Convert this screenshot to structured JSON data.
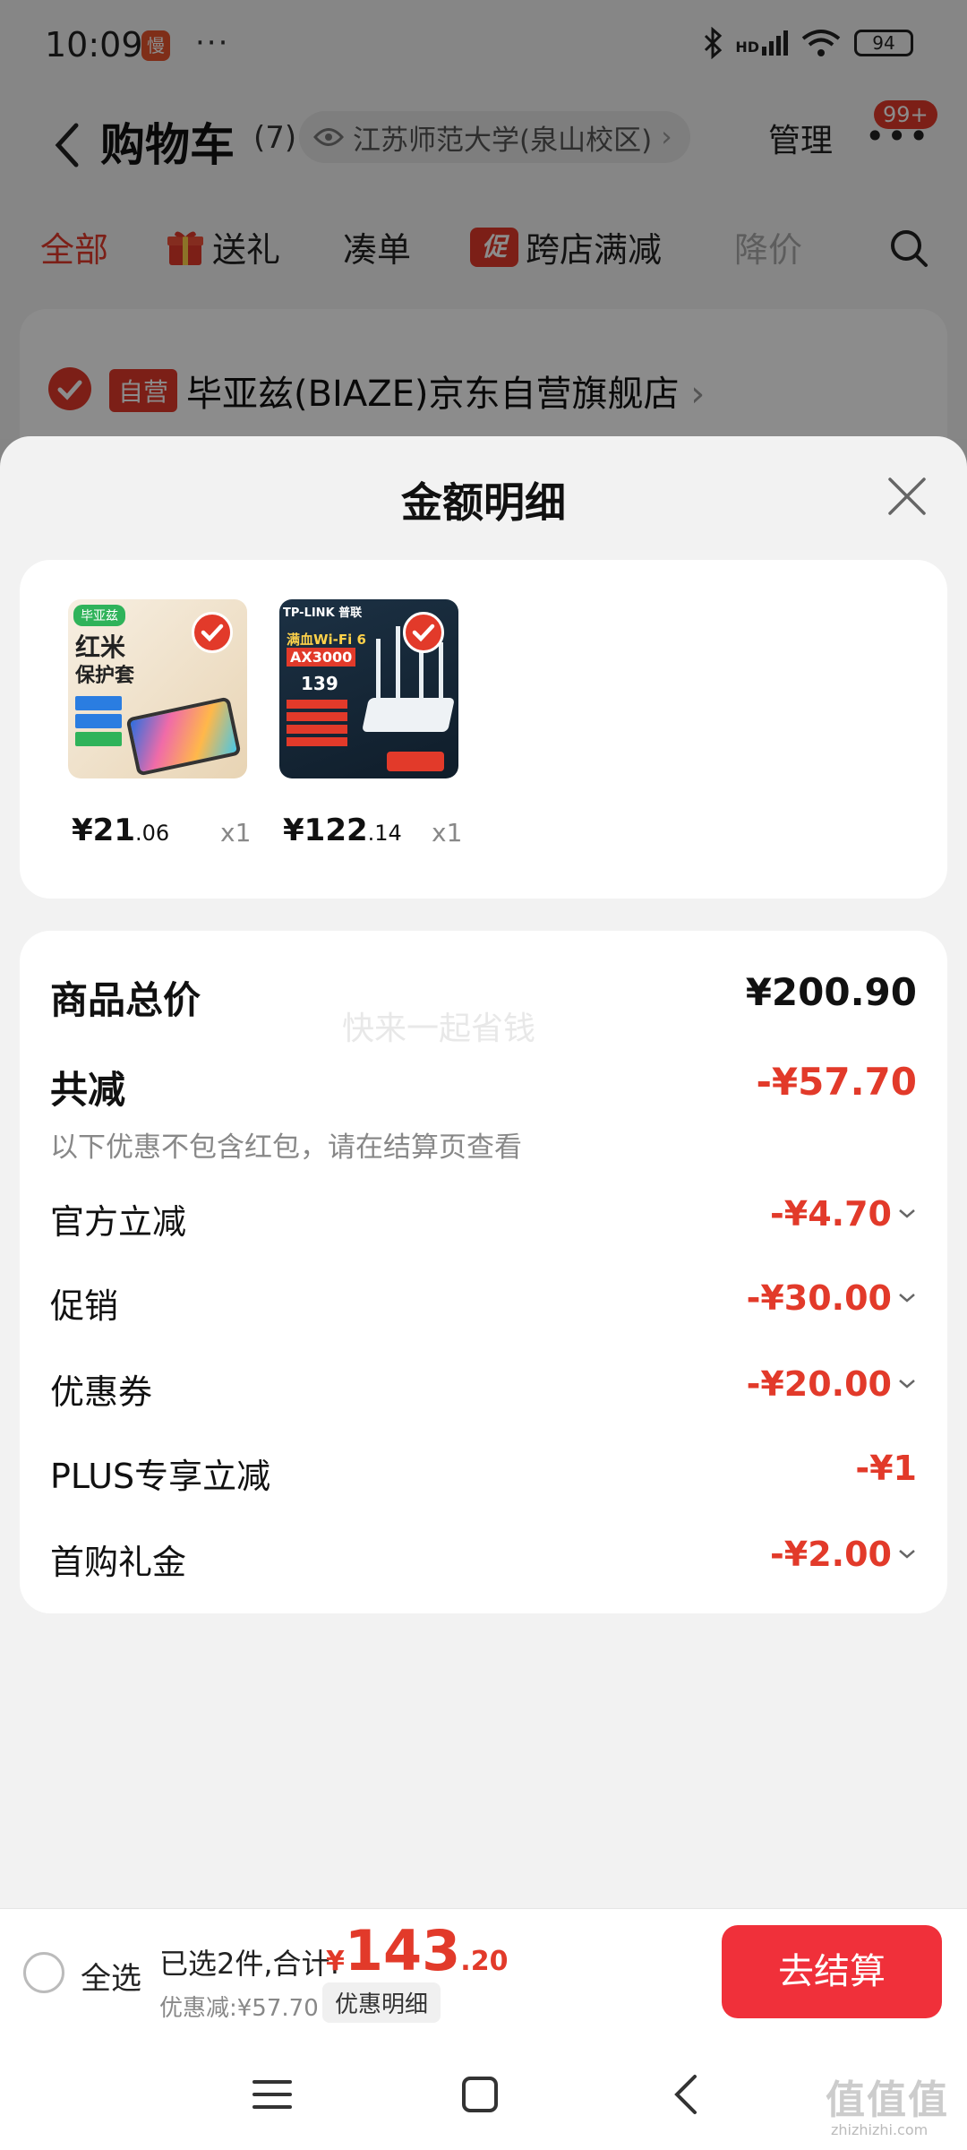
{
  "status_bar": {
    "time": "10:09",
    "app_icon_text": "慢",
    "dots": "···",
    "signal_text": "HD",
    "battery": "94"
  },
  "header": {
    "title": "购物车",
    "count": "(7)",
    "location": "江苏师范大学(泉山校区)",
    "location_arrow": "›",
    "manage": "管理",
    "badge": "99+"
  },
  "filter_tabs": [
    {
      "label": "全部"
    },
    {
      "label": "送礼"
    },
    {
      "label": "凑单"
    },
    {
      "label": "跨店满减",
      "tag": "促"
    },
    {
      "label": "降价"
    }
  ],
  "store": {
    "tag": "自营",
    "name": "毕亚兹(BIAZE)京东自营旗舰店",
    "arrow": "›"
  },
  "sheet": {
    "title": "金额明细",
    "products": [
      {
        "name": "红米保护套",
        "brand": "毕亚兹",
        "thumb_lines": [
          "红米",
          "保护套"
        ],
        "price_int": "¥21",
        "price_dec": ".06",
        "qty": "x1"
      },
      {
        "name": "TP-LINK AX3000路由器",
        "brand": "TP-LINK 普联",
        "thumb_lines": [
          "满血Wi-Fi 6",
          "AX3000",
          "139"
        ],
        "price_int": "¥122",
        "price_dec": ".14",
        "qty": "x1"
      }
    ],
    "summary": {
      "total_label": "商品总价",
      "total_value": "¥200.90",
      "watermark": "快来一起省钱",
      "reduce_label": "共减",
      "reduce_value": "-¥57.70",
      "hint": "以下优惠不包含红包，请在结算页查看",
      "items": [
        {
          "label": "官方立减",
          "value": "-¥4.70",
          "expandable": true
        },
        {
          "label": "促销",
          "value": "-¥30.00",
          "expandable": true
        },
        {
          "label": "优惠券",
          "value": "-¥20.00",
          "expandable": true
        },
        {
          "label": "PLUS专享立减",
          "value": "-¥1",
          "expandable": false
        },
        {
          "label": "首购礼金",
          "value": "-¥2.00",
          "expandable": true
        }
      ]
    }
  },
  "bottom_bar": {
    "select_all": "全选",
    "selected": "已选2件,合计:",
    "currency": "¥",
    "total_int": "143",
    "total_dec": ".20",
    "discount": "优惠减:¥57.70",
    "detail_link": "优惠明细",
    "checkout": "去结算"
  },
  "watermark": {
    "mark": "值值值",
    "site": "zhizhizhi.com"
  },
  "colors": {
    "accent": "#e23a2a",
    "checkout": "#f0303a"
  }
}
